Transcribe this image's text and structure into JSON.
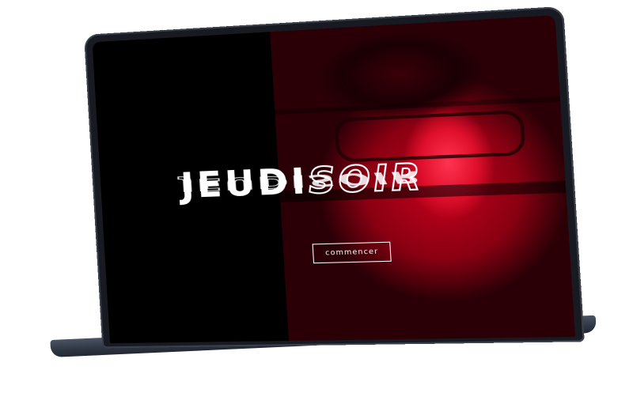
{
  "hero": {
    "title_part1": "JEUDI",
    "title_part2": "SOIR",
    "cta_label": "commencer"
  },
  "colors": {
    "accent": "#e0102c",
    "background": "#000000",
    "text": "#ffffff"
  }
}
